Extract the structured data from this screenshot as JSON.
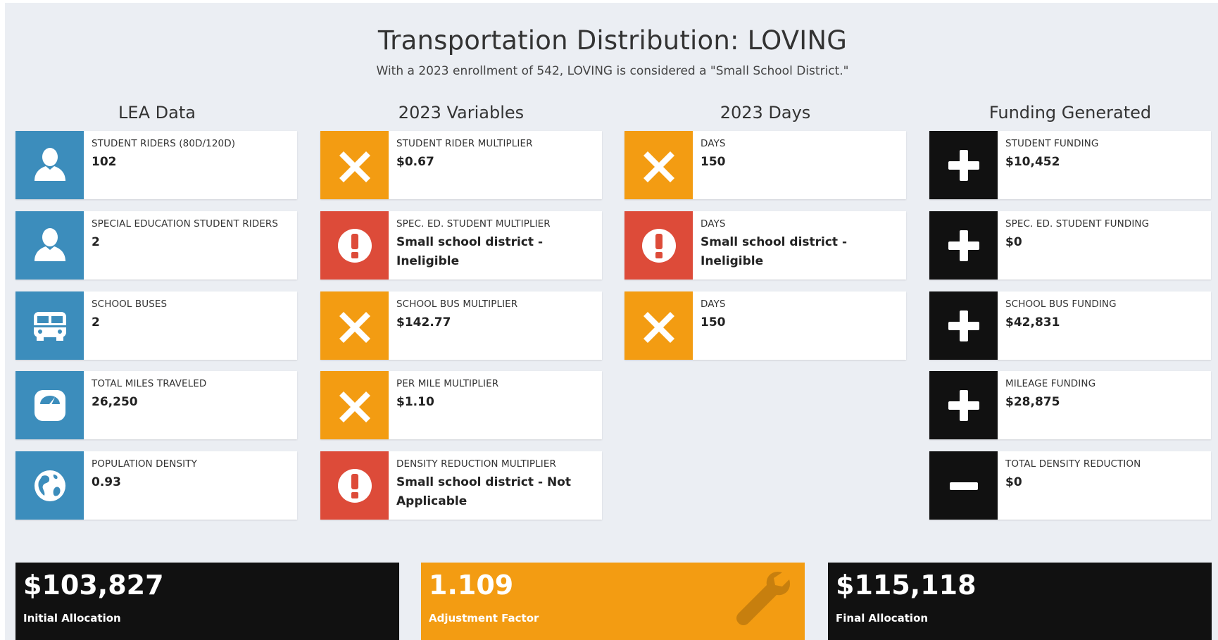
{
  "header": {
    "title": "Transportation Distribution: LOVING",
    "subtitle": "With a 2023 enrollment of 542, LOVING is considered a \"Small School District.\""
  },
  "columns": {
    "lea_data": {
      "heading": "LEA Data",
      "boxes": [
        {
          "label": "Student Riders (80D/120D)",
          "value": "102",
          "icon": "user-icon"
        },
        {
          "label": "Special Education Student Riders",
          "value": "2",
          "icon": "user-icon"
        },
        {
          "label": "School Buses",
          "value": "2",
          "icon": "bus-icon"
        },
        {
          "label": "Total Miles Traveled",
          "value": "26,250",
          "icon": "tachometer-icon"
        },
        {
          "label": "Population Density",
          "value": "0.93",
          "icon": "globe-icon"
        }
      ]
    },
    "variables": {
      "heading": "2023 Variables",
      "boxes": [
        {
          "label": "Student Rider Multiplier",
          "value": "$0.67",
          "icon": "times-icon"
        },
        {
          "label": "Spec. Ed. Student Multiplier",
          "value": "Small school district - Ineligible",
          "icon": "exclamation-icon"
        },
        {
          "label": "School Bus Multiplier",
          "value": "$142.77",
          "icon": "times-icon"
        },
        {
          "label": "Per Mile Multiplier",
          "value": "$1.10",
          "icon": "times-icon"
        },
        {
          "label": "Density Reduction Multiplier",
          "value": "Small school district - Not Applicable",
          "icon": "exclamation-icon"
        }
      ]
    },
    "days": {
      "heading": "2023 Days",
      "boxes": [
        {
          "label": "Days",
          "value": "150",
          "icon": "times-icon"
        },
        {
          "label": "Days",
          "value": "Small school district - Ineligible",
          "icon": "exclamation-icon"
        },
        {
          "label": "Days",
          "value": "150",
          "icon": "times-icon"
        }
      ]
    },
    "funding": {
      "heading": "Funding Generated",
      "boxes": [
        {
          "label": "Student Funding",
          "value": "$10,452",
          "icon": "plus-icon"
        },
        {
          "label": "Spec. Ed. Student Funding",
          "value": "$0",
          "icon": "plus-icon"
        },
        {
          "label": "School Bus Funding",
          "value": "$42,831",
          "icon": "plus-icon"
        },
        {
          "label": "Mileage Funding",
          "value": "$28,875",
          "icon": "plus-icon"
        },
        {
          "label": "Total Density Reduction",
          "value": "$0",
          "icon": "minus-icon"
        }
      ]
    }
  },
  "summary": {
    "initial": {
      "value": "$103,827",
      "caption": "Initial Allocation"
    },
    "adjustment": {
      "value": "1.109",
      "caption": "Adjustment Factor",
      "icon": "wrench-icon"
    },
    "final": {
      "value": "$115,118",
      "caption": "Final Allocation"
    }
  },
  "colors": {
    "blue": "#3c8dbc",
    "orange": "#f39c12",
    "red": "#dd4b39",
    "black": "#111111",
    "background": "#ebeef3"
  }
}
